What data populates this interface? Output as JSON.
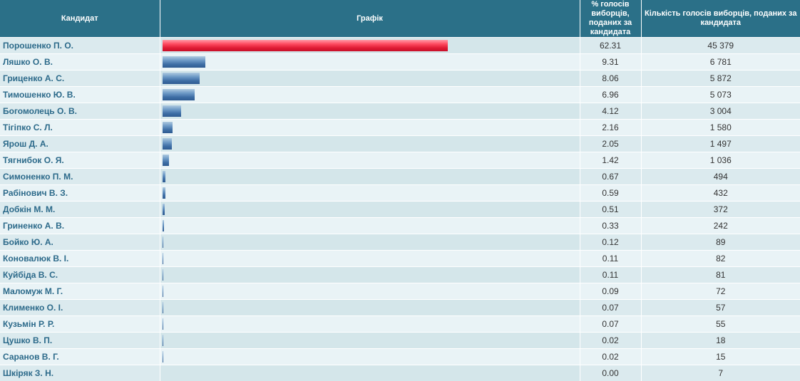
{
  "headers": {
    "candidate": "Кандидат",
    "chart": "Графік",
    "percent": "% голосів виборців, поданих за кандидата",
    "votes": "Кількість голосів виборців, поданих за кандидата"
  },
  "colors": {
    "lead_bar": "#e8223a",
    "bar": "#3f6fa6",
    "header_bg": "#2b7088"
  },
  "chart_data": {
    "type": "bar",
    "orientation": "horizontal",
    "scale_max_percent": 100,
    "categories": [
      "Порошенко П. О.",
      "Ляшко О. В.",
      "Гриценко А. С.",
      "Тимошенко Ю. В.",
      "Богомолець О. В.",
      "Тігіпко С. Л.",
      "Ярош Д. А.",
      "Тягнибок О. Я.",
      "Симоненко П. М.",
      "Рабінович В. З.",
      "Добкін М. М.",
      "Гриненко А. В.",
      "Бойко Ю. А.",
      "Коновалюк В. І.",
      "Куйбіда В. С.",
      "Маломуж М. Г.",
      "Клименко О. І.",
      "Кузьмін Р. Р.",
      "Цушко В. П.",
      "Саранов В. Г.",
      "Шкіряк З. Н."
    ],
    "percents": [
      62.31,
      9.31,
      8.06,
      6.96,
      4.12,
      2.16,
      2.05,
      1.42,
      0.67,
      0.59,
      0.51,
      0.33,
      0.12,
      0.11,
      0.11,
      0.09,
      0.07,
      0.07,
      0.02,
      0.02,
      0.0
    ],
    "percent_labels": [
      "62.31",
      "9.31",
      "8.06",
      "6.96",
      "4.12",
      "2.16",
      "2.05",
      "1.42",
      "0.67",
      "0.59",
      "0.51",
      "0.33",
      "0.12",
      "0.11",
      "0.11",
      "0.09",
      "0.07",
      "0.07",
      "0.02",
      "0.02",
      "0.00"
    ],
    "vote_labels": [
      "45 379",
      "6 781",
      "5 872",
      "5 073",
      "3 004",
      "1 580",
      "1 497",
      "1 036",
      "494",
      "432",
      "372",
      "242",
      "89",
      "82",
      "81",
      "72",
      "57",
      "55",
      "18",
      "15",
      "7"
    ]
  }
}
